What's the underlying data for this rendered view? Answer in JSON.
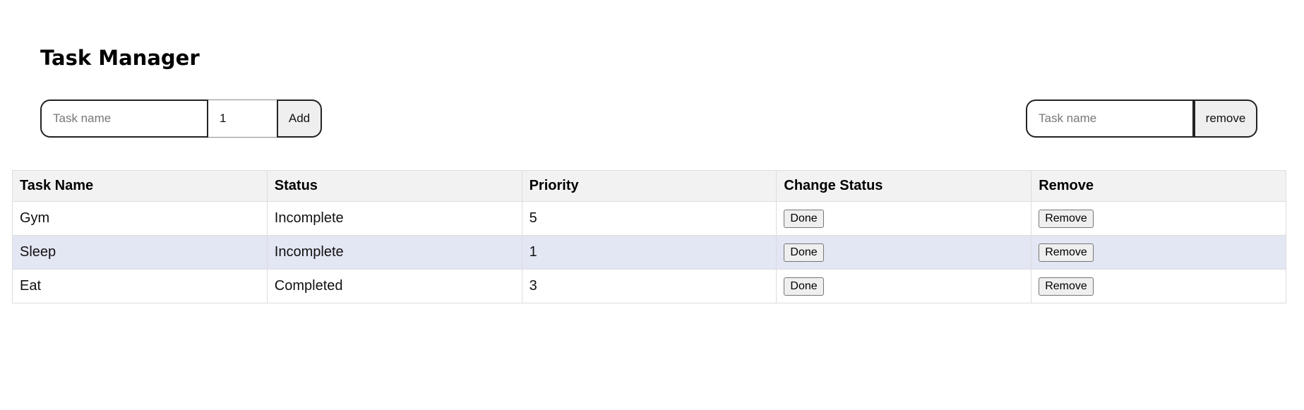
{
  "header": {
    "title": "Task Manager"
  },
  "add_form": {
    "name_placeholder": "Task name",
    "priority_value": "1",
    "add_label": "Add"
  },
  "remove_form": {
    "name_placeholder": "Task name",
    "remove_label": "remove"
  },
  "table": {
    "headers": [
      "Task Name",
      "Status",
      "Priority",
      "Change Status",
      "Remove"
    ],
    "rows": [
      {
        "name": "Gym",
        "status": "Incomplete",
        "priority": "5",
        "change_label": "Done",
        "remove_label": "Remove"
      },
      {
        "name": "Sleep",
        "status": "Incomplete",
        "priority": "1",
        "change_label": "Done",
        "remove_label": "Remove"
      },
      {
        "name": "Eat",
        "status": "Completed",
        "priority": "3",
        "change_label": "Done",
        "remove_label": "Remove"
      }
    ]
  },
  "colors": {
    "header_bg": "#f2f2f2",
    "alt_row_bg": "#e3e6f3",
    "border": "#dddddd"
  }
}
